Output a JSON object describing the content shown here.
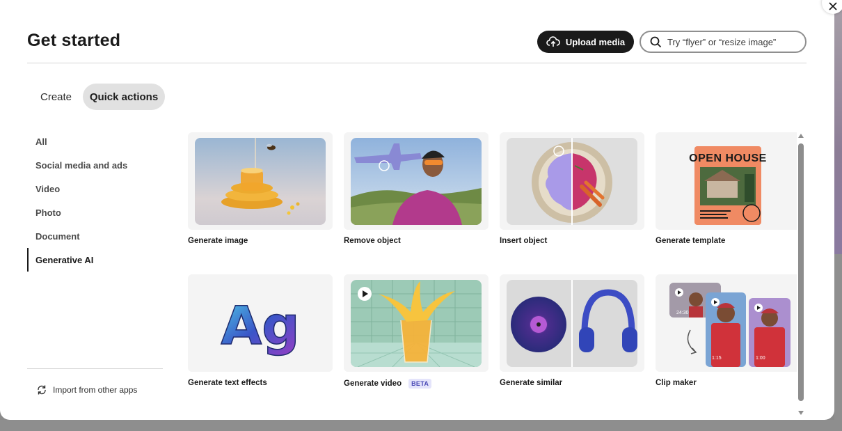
{
  "header": {
    "title": "Get started",
    "upload_label": "Upload media",
    "search_placeholder": "Try “flyer” or “resize image”"
  },
  "tabs": [
    {
      "label": "Create",
      "active": false
    },
    {
      "label": "Quick actions",
      "active": true
    }
  ],
  "sidebar": {
    "items": [
      {
        "label": "All"
      },
      {
        "label": "Social media and ads"
      },
      {
        "label": "Video"
      },
      {
        "label": "Photo"
      },
      {
        "label": "Document"
      },
      {
        "label": "Generative AI",
        "active": true
      }
    ],
    "import_label": "Import from other apps"
  },
  "cards": [
    {
      "label": "Generate image",
      "icon": "honey-jar-image"
    },
    {
      "label": "Remove object",
      "icon": "cyclist-image"
    },
    {
      "label": "Insert object",
      "icon": "food-plate-image"
    },
    {
      "label": "Generate template",
      "icon": "open-house-poster-image"
    },
    {
      "label": "Generate text effects",
      "icon": "text-effects-image"
    },
    {
      "label": "Generate video",
      "badge": "BETA",
      "icon": "juice-splash-image"
    },
    {
      "label": "Generate similar",
      "icon": "vinyl-headphones-image"
    },
    {
      "label": "Clip maker",
      "icon": "video-clips-image"
    }
  ],
  "thumb_text": {
    "poster_title": "OPEN HOUSE",
    "text_effect": "Ag",
    "clip_time_1": "24:30",
    "clip_time_2": "1:15",
    "clip_time_3": "1:00"
  },
  "colors": {
    "accent": "#1a1a1a",
    "selected_tab_bg": "#e1e1e1",
    "beta_badge": "#4b4bb6"
  }
}
